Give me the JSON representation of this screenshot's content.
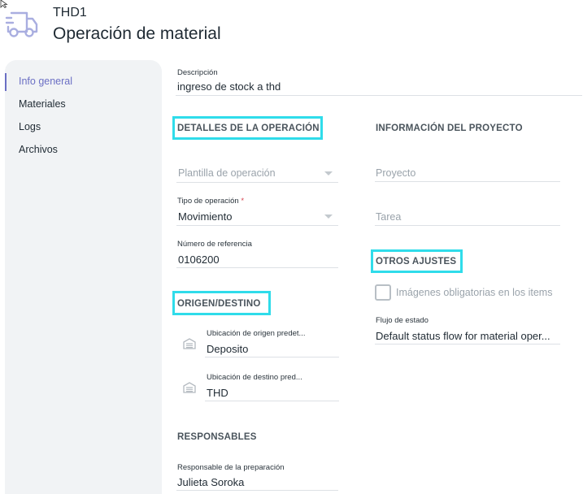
{
  "header": {
    "code": "THD1",
    "title": "Operación de material",
    "icon": "delivery-truck-icon"
  },
  "sidebar": {
    "items": [
      {
        "label": "Info general",
        "active": true
      },
      {
        "label": "Materiales",
        "active": false
      },
      {
        "label": "Logs",
        "active": false
      },
      {
        "label": "Archivos",
        "active": false
      }
    ]
  },
  "form": {
    "descripcion": {
      "label": "Descripción",
      "value": "ingreso de stock a thd"
    },
    "detalles": {
      "section": "DETALLES DE LA OPERACIÓN",
      "plantilla": {
        "placeholder": "Plantilla de operación"
      },
      "tipo": {
        "label": "Tipo de operación",
        "required_mark": "*",
        "value": "Movimiento"
      },
      "referencia": {
        "label": "Número de referencia",
        "value": "0106200"
      }
    },
    "origen": {
      "section": "ORIGEN/DESTINO",
      "origen": {
        "label": "Ubicación de origen predet...",
        "value": "Deposito"
      },
      "destino": {
        "label": "Ubicación de destino pred...",
        "value": "THD"
      }
    },
    "responsables": {
      "section": "RESPONSABLES",
      "preparacion": {
        "label": "Responsable de la preparación",
        "value": "Julieta Soroka"
      }
    },
    "proyecto": {
      "section": "INFORMACIÓN DEL PROYECTO",
      "proyecto": {
        "placeholder": "Proyecto"
      },
      "tarea": {
        "placeholder": "Tarea"
      }
    },
    "otros": {
      "section": "OTROS AJUSTES",
      "imagenes": {
        "label": "Imágenes obligatorias en los items",
        "checked": false
      },
      "flujo": {
        "label": "Flujo de estado",
        "value": "Default status flow for material oper..."
      }
    }
  },
  "colors": {
    "accent": "#6b6fc4",
    "highlight": "#2fdcea",
    "sidebar_bg": "#f1f3f5"
  }
}
